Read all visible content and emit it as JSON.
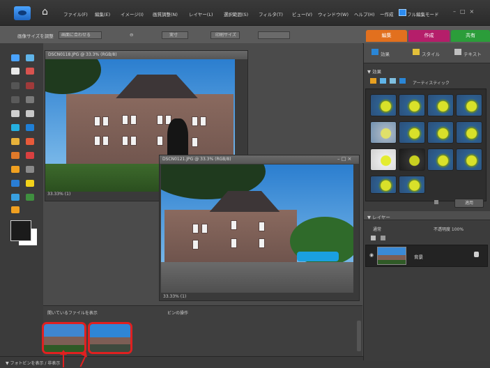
{
  "menubar": {
    "home_icon": "home-icon",
    "items": [
      "ファイル(F)",
      "編集(E)",
      "イメージ(I)",
      "画質調整(N)",
      "レイヤー(L)",
      "選択範囲(S)",
      "フィルタ(T)",
      "ビュー(V)",
      "ウィンドウ(W)",
      "ヘルプ(H)"
    ],
    "mode_label": "フル編集モード",
    "mode_menu": "ー作成"
  },
  "options": {
    "label1": "画像サイズを調整",
    "field1": "画面に合わせる",
    "label2": "実寸",
    "label3": "印刷サイズ"
  },
  "mode_tabs": [
    {
      "label": "編集",
      "color": "#e2701e"
    },
    {
      "label": "作成",
      "color": "#b51e6a"
    },
    {
      "label": "共有",
      "color": "#2b9d3a"
    }
  ],
  "documents": [
    {
      "title": "DSCN0118.JPG @ 33.3% (RGB/8)",
      "status": "33.33% (1)"
    },
    {
      "title": "DSCN0121.JPG @ 33.3% (RGB/8)",
      "status": "33.33% (1)"
    }
  ],
  "photo_bin": {
    "source_label": "開いているファイルを表示",
    "options_label": "ビンの操作",
    "footer_label": "▼ フォトビンを表示 / 非表示"
  },
  "panel": {
    "tabs": [
      "効果",
      "スタイル",
      "テキスト"
    ],
    "section_title": "▼ 効果",
    "category": "アーティスティック",
    "apply_label": "適用",
    "layers_title": "▼ レイヤー",
    "blend_mode": "通常",
    "opacity_label": "不透明度 100%",
    "layer_name": "背景"
  }
}
